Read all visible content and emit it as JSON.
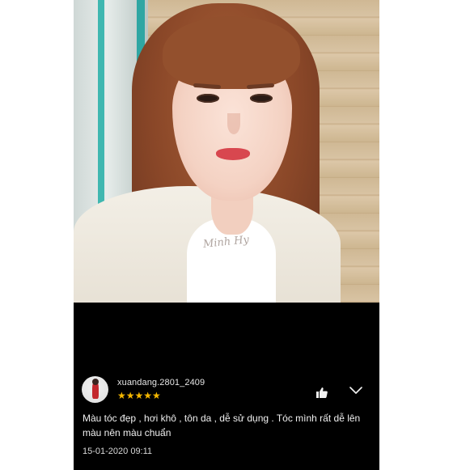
{
  "photo": {
    "watermark": "Minh Hy"
  },
  "review": {
    "username": "xuandang.2801_2409",
    "rating": 5,
    "stars": "★★★★★",
    "comment": "Màu tóc đẹp , hơi khô , tôn da , dễ sử dụng . Tóc mình rất dễ lên màu nên màu chuẩn",
    "date": "15-01-2020 09:11",
    "icons": {
      "like": "thumbs-up-icon",
      "expand": "chevron-down-icon"
    }
  },
  "colors": {
    "background": "#000000",
    "text": "#f0f0f0",
    "star": "#f5b700"
  }
}
